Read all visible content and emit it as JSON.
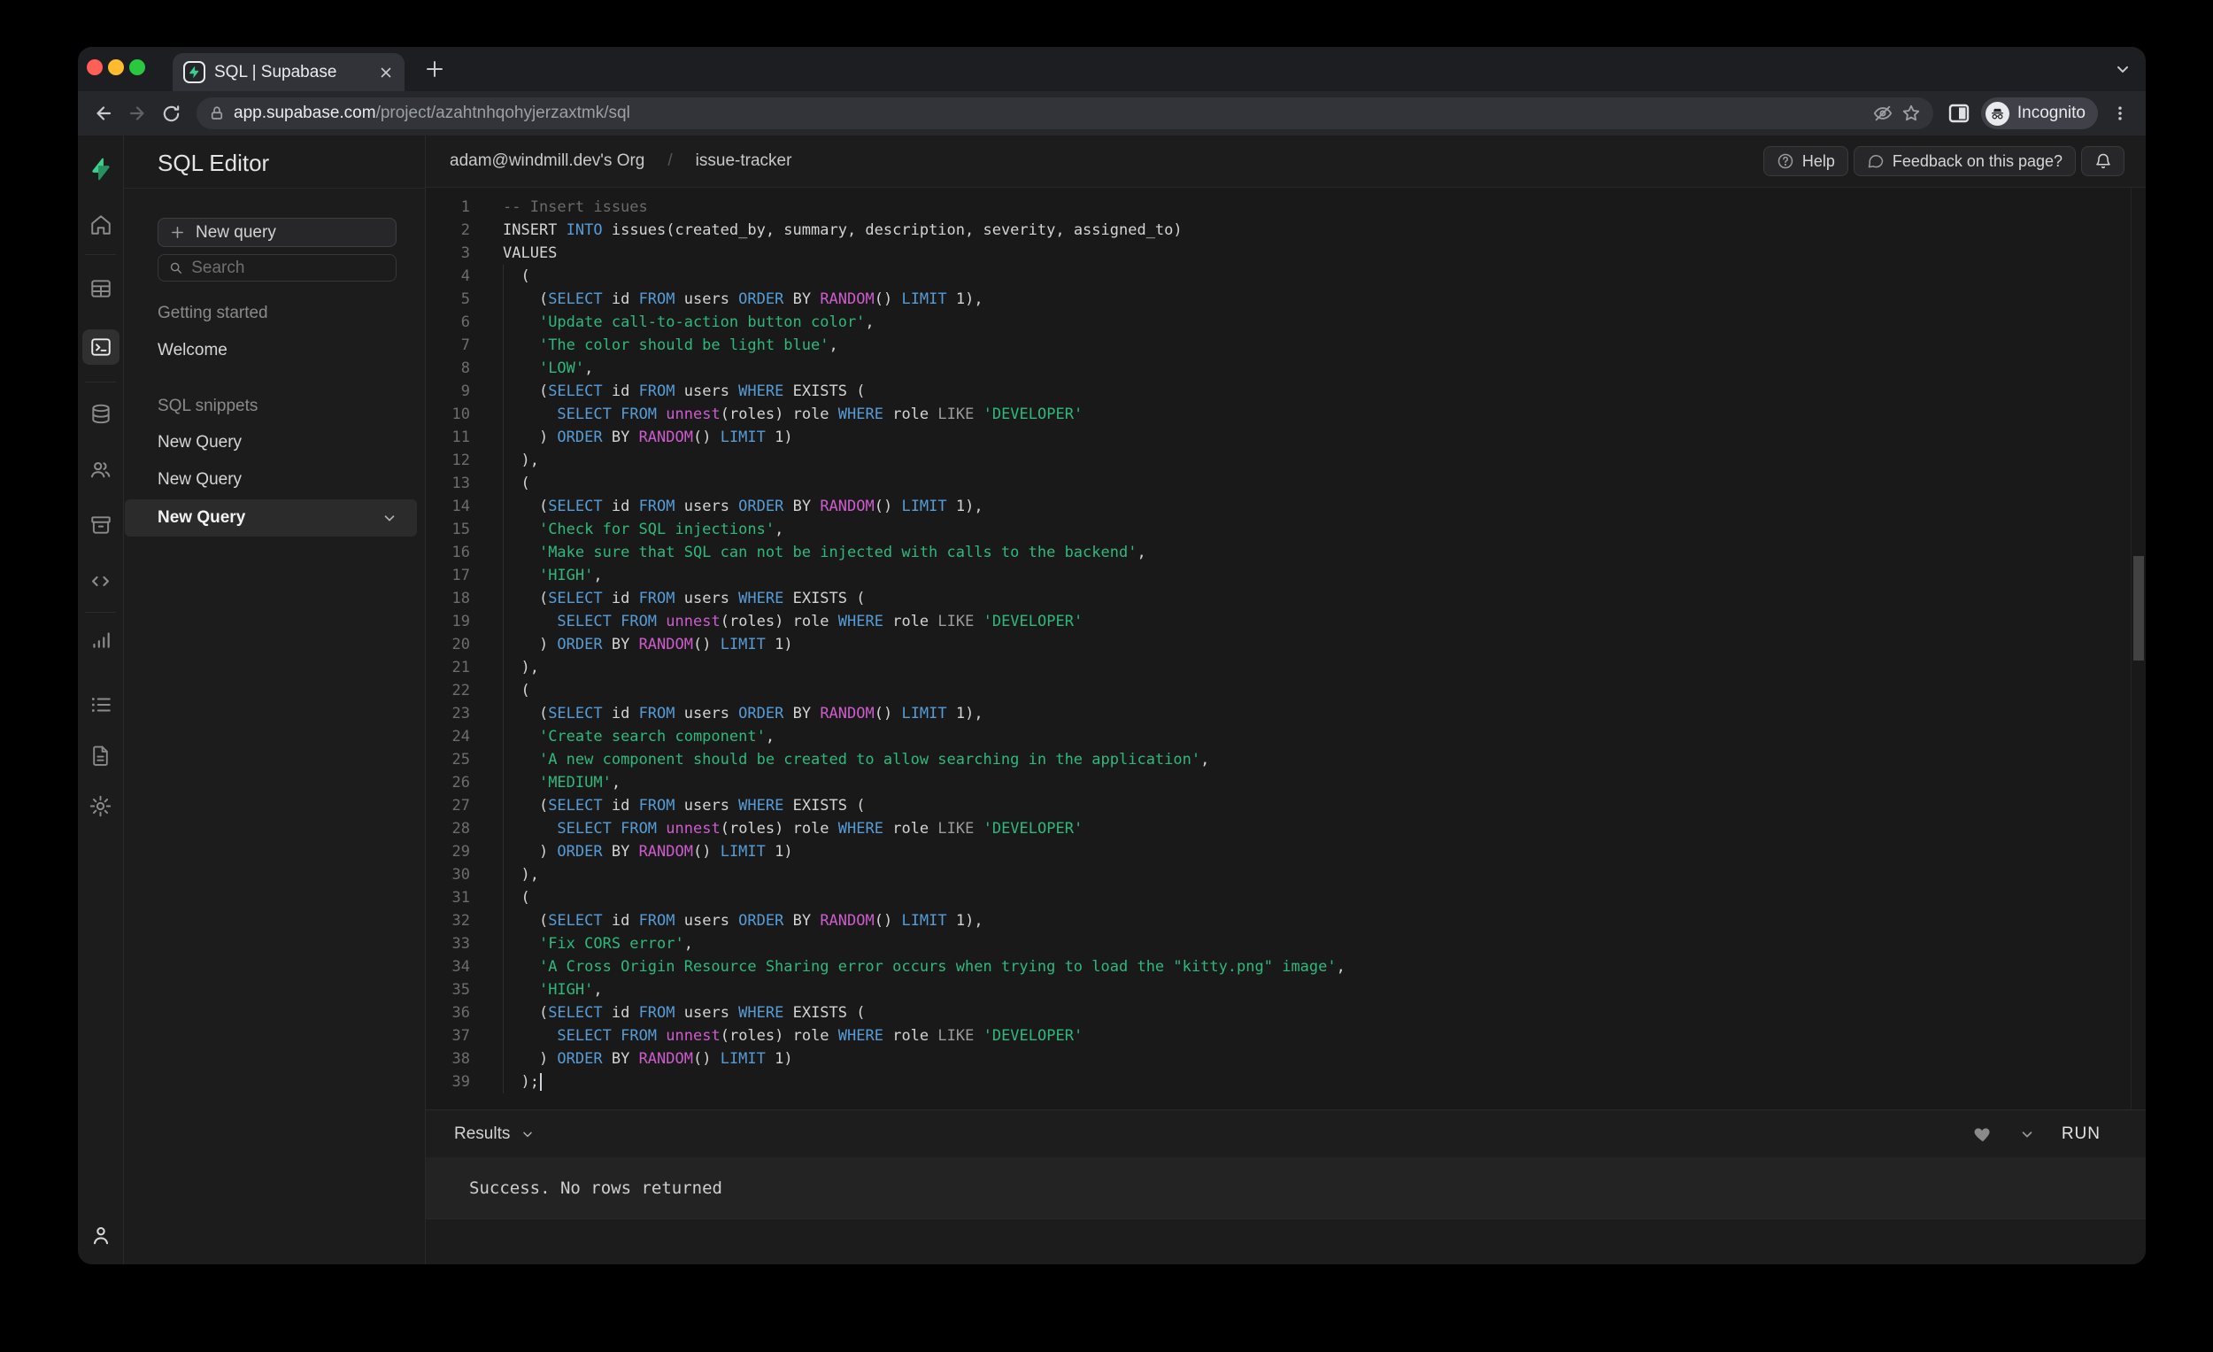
{
  "browser": {
    "tab_title": "SQL | Supabase",
    "url_host": "app.supabase.com",
    "url_path": "/project/azahtnhqohyjerzaxtmk/sql",
    "incognito_label": "Incognito"
  },
  "header": {
    "breadcrumb_org": "adam@windmill.dev's Org",
    "breadcrumb_separator": "/",
    "breadcrumb_project": "issue-tracker",
    "help_label": "Help",
    "feedback_label": "Feedback on this page?"
  },
  "sidebar_panel": {
    "title": "SQL Editor",
    "new_query_button": "New query",
    "search_placeholder": "Search",
    "sections": [
      {
        "heading": "Getting started",
        "items": [
          "Welcome"
        ]
      },
      {
        "heading": "SQL snippets",
        "items": [
          "New Query",
          "New Query",
          "New Query"
        ]
      }
    ],
    "active_item_index": 2
  },
  "results": {
    "label": "Results",
    "run_label": "RUN",
    "message": "Success. No rows returned"
  },
  "colors": {
    "accent_green": "#3ecf8e",
    "editor_bg": "#191919",
    "token_keyword": "#569cd6",
    "token_function": "#cd5ccd",
    "token_string": "#2db97c",
    "token_comment": "#6a6a6a",
    "token_default": "#d4d4d4"
  },
  "editor": {
    "cursor_line": 39,
    "lines": [
      [
        [
          "c",
          "-- Insert issues"
        ]
      ],
      [
        [
          "d",
          "INSERT "
        ],
        [
          "k",
          "INTO"
        ],
        [
          "d",
          " issues(created_by, summary, description, severity, assigned_to)"
        ]
      ],
      [
        [
          "d",
          "VALUES"
        ]
      ],
      [
        [
          "d",
          "  ("
        ]
      ],
      [
        [
          "d",
          "    ("
        ],
        [
          "k",
          "SELECT"
        ],
        [
          "d",
          " id "
        ],
        [
          "k",
          "FROM"
        ],
        [
          "d",
          " users "
        ],
        [
          "k",
          "ORDER"
        ],
        [
          "d",
          " BY "
        ],
        [
          "f",
          "RANDOM"
        ],
        [
          "d",
          "() "
        ],
        [
          "k",
          "LIMIT"
        ],
        [
          "d",
          " 1),"
        ]
      ],
      [
        [
          "d",
          "    "
        ],
        [
          "s",
          "'Update call-to-action button color'"
        ],
        [
          "d",
          ","
        ]
      ],
      [
        [
          "d",
          "    "
        ],
        [
          "s",
          "'The color should be light blue'"
        ],
        [
          "d",
          ","
        ]
      ],
      [
        [
          "d",
          "    "
        ],
        [
          "s",
          "'LOW'"
        ],
        [
          "d",
          ","
        ]
      ],
      [
        [
          "d",
          "    ("
        ],
        [
          "k",
          "SELECT"
        ],
        [
          "d",
          " id "
        ],
        [
          "k",
          "FROM"
        ],
        [
          "d",
          " users "
        ],
        [
          "k",
          "WHERE"
        ],
        [
          "d",
          " EXISTS ("
        ]
      ],
      [
        [
          "d",
          "      "
        ],
        [
          "k",
          "SELECT"
        ],
        [
          "d",
          " "
        ],
        [
          "k",
          "FROM"
        ],
        [
          "d",
          " "
        ],
        [
          "f",
          "unnest"
        ],
        [
          "d",
          "(roles) role "
        ],
        [
          "k",
          "WHERE"
        ],
        [
          "d",
          " role "
        ],
        [
          "g",
          "LIKE"
        ],
        [
          "d",
          " "
        ],
        [
          "s",
          "'DEVELOPER'"
        ]
      ],
      [
        [
          "d",
          "    ) "
        ],
        [
          "k",
          "ORDER"
        ],
        [
          "d",
          " BY "
        ],
        [
          "f",
          "RANDOM"
        ],
        [
          "d",
          "() "
        ],
        [
          "k",
          "LIMIT"
        ],
        [
          "d",
          " 1)"
        ]
      ],
      [
        [
          "d",
          "  ),"
        ]
      ],
      [
        [
          "d",
          "  ("
        ]
      ],
      [
        [
          "d",
          "    ("
        ],
        [
          "k",
          "SELECT"
        ],
        [
          "d",
          " id "
        ],
        [
          "k",
          "FROM"
        ],
        [
          "d",
          " users "
        ],
        [
          "k",
          "ORDER"
        ],
        [
          "d",
          " BY "
        ],
        [
          "f",
          "RANDOM"
        ],
        [
          "d",
          "() "
        ],
        [
          "k",
          "LIMIT"
        ],
        [
          "d",
          " 1),"
        ]
      ],
      [
        [
          "d",
          "    "
        ],
        [
          "s",
          "'Check for SQL injections'"
        ],
        [
          "d",
          ","
        ]
      ],
      [
        [
          "d",
          "    "
        ],
        [
          "s",
          "'Make sure that SQL can not be injected with calls to the backend'"
        ],
        [
          "d",
          ","
        ]
      ],
      [
        [
          "d",
          "    "
        ],
        [
          "s",
          "'HIGH'"
        ],
        [
          "d",
          ","
        ]
      ],
      [
        [
          "d",
          "    ("
        ],
        [
          "k",
          "SELECT"
        ],
        [
          "d",
          " id "
        ],
        [
          "k",
          "FROM"
        ],
        [
          "d",
          " users "
        ],
        [
          "k",
          "WHERE"
        ],
        [
          "d",
          " EXISTS ("
        ]
      ],
      [
        [
          "d",
          "      "
        ],
        [
          "k",
          "SELECT"
        ],
        [
          "d",
          " "
        ],
        [
          "k",
          "FROM"
        ],
        [
          "d",
          " "
        ],
        [
          "f",
          "unnest"
        ],
        [
          "d",
          "(roles) role "
        ],
        [
          "k",
          "WHERE"
        ],
        [
          "d",
          " role "
        ],
        [
          "g",
          "LIKE"
        ],
        [
          "d",
          " "
        ],
        [
          "s",
          "'DEVELOPER'"
        ]
      ],
      [
        [
          "d",
          "    ) "
        ],
        [
          "k",
          "ORDER"
        ],
        [
          "d",
          " BY "
        ],
        [
          "f",
          "RANDOM"
        ],
        [
          "d",
          "() "
        ],
        [
          "k",
          "LIMIT"
        ],
        [
          "d",
          " 1)"
        ]
      ],
      [
        [
          "d",
          "  ),"
        ]
      ],
      [
        [
          "d",
          "  ("
        ]
      ],
      [
        [
          "d",
          "    ("
        ],
        [
          "k",
          "SELECT"
        ],
        [
          "d",
          " id "
        ],
        [
          "k",
          "FROM"
        ],
        [
          "d",
          " users "
        ],
        [
          "k",
          "ORDER"
        ],
        [
          "d",
          " BY "
        ],
        [
          "f",
          "RANDOM"
        ],
        [
          "d",
          "() "
        ],
        [
          "k",
          "LIMIT"
        ],
        [
          "d",
          " 1),"
        ]
      ],
      [
        [
          "d",
          "    "
        ],
        [
          "s",
          "'Create search component'"
        ],
        [
          "d",
          ","
        ]
      ],
      [
        [
          "d",
          "    "
        ],
        [
          "s",
          "'A new component should be created to allow searching in the application'"
        ],
        [
          "d",
          ","
        ]
      ],
      [
        [
          "d",
          "    "
        ],
        [
          "s",
          "'MEDIUM'"
        ],
        [
          "d",
          ","
        ]
      ],
      [
        [
          "d",
          "    ("
        ],
        [
          "k",
          "SELECT"
        ],
        [
          "d",
          " id "
        ],
        [
          "k",
          "FROM"
        ],
        [
          "d",
          " users "
        ],
        [
          "k",
          "WHERE"
        ],
        [
          "d",
          " EXISTS ("
        ]
      ],
      [
        [
          "d",
          "      "
        ],
        [
          "k",
          "SELECT"
        ],
        [
          "d",
          " "
        ],
        [
          "k",
          "FROM"
        ],
        [
          "d",
          " "
        ],
        [
          "f",
          "unnest"
        ],
        [
          "d",
          "(roles) role "
        ],
        [
          "k",
          "WHERE"
        ],
        [
          "d",
          " role "
        ],
        [
          "g",
          "LIKE"
        ],
        [
          "d",
          " "
        ],
        [
          "s",
          "'DEVELOPER'"
        ]
      ],
      [
        [
          "d",
          "    ) "
        ],
        [
          "k",
          "ORDER"
        ],
        [
          "d",
          " BY "
        ],
        [
          "f",
          "RANDOM"
        ],
        [
          "d",
          "() "
        ],
        [
          "k",
          "LIMIT"
        ],
        [
          "d",
          " 1)"
        ]
      ],
      [
        [
          "d",
          "  ),"
        ]
      ],
      [
        [
          "d",
          "  ("
        ]
      ],
      [
        [
          "d",
          "    ("
        ],
        [
          "k",
          "SELECT"
        ],
        [
          "d",
          " id "
        ],
        [
          "k",
          "FROM"
        ],
        [
          "d",
          " users "
        ],
        [
          "k",
          "ORDER"
        ],
        [
          "d",
          " BY "
        ],
        [
          "f",
          "RANDOM"
        ],
        [
          "d",
          "() "
        ],
        [
          "k",
          "LIMIT"
        ],
        [
          "d",
          " 1),"
        ]
      ],
      [
        [
          "d",
          "    "
        ],
        [
          "s",
          "'Fix CORS error'"
        ],
        [
          "d",
          ","
        ]
      ],
      [
        [
          "d",
          "    "
        ],
        [
          "s",
          "'A Cross Origin Resource Sharing error occurs when trying to load the \"kitty.png\" image'"
        ],
        [
          "d",
          ","
        ]
      ],
      [
        [
          "d",
          "    "
        ],
        [
          "s",
          "'HIGH'"
        ],
        [
          "d",
          ","
        ]
      ],
      [
        [
          "d",
          "    ("
        ],
        [
          "k",
          "SELECT"
        ],
        [
          "d",
          " id "
        ],
        [
          "k",
          "FROM"
        ],
        [
          "d",
          " users "
        ],
        [
          "k",
          "WHERE"
        ],
        [
          "d",
          " EXISTS ("
        ]
      ],
      [
        [
          "d",
          "      "
        ],
        [
          "k",
          "SELECT"
        ],
        [
          "d",
          " "
        ],
        [
          "k",
          "FROM"
        ],
        [
          "d",
          " "
        ],
        [
          "f",
          "unnest"
        ],
        [
          "d",
          "(roles) role "
        ],
        [
          "k",
          "WHERE"
        ],
        [
          "d",
          " role "
        ],
        [
          "g",
          "LIKE"
        ],
        [
          "d",
          " "
        ],
        [
          "s",
          "'DEVELOPER'"
        ]
      ],
      [
        [
          "d",
          "    ) "
        ],
        [
          "k",
          "ORDER"
        ],
        [
          "d",
          " BY "
        ],
        [
          "f",
          "RANDOM"
        ],
        [
          "d",
          "() "
        ],
        [
          "k",
          "LIMIT"
        ],
        [
          "d",
          " 1)"
        ]
      ],
      [
        [
          "d",
          "  );"
        ]
      ]
    ]
  }
}
